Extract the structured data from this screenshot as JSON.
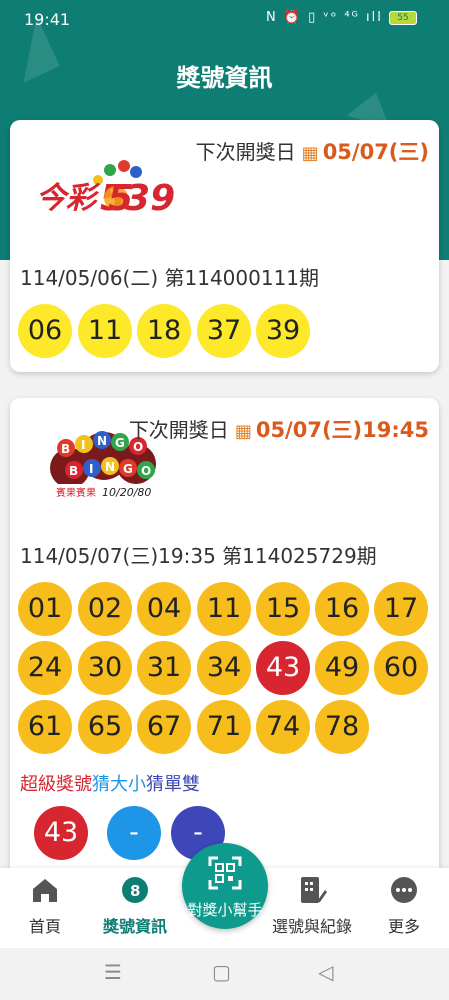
{
  "status_bar": {
    "time": "19:41",
    "icons": "N ⏰ ▯ ᵛᵒ ⁴ᴳ ıll",
    "battery": "55"
  },
  "header": {
    "title": "獎號資訊"
  },
  "card1": {
    "logo_text": "今彩539",
    "next_label": "下次開獎日",
    "next_date": "05/07(三)",
    "period": "114/05/06(二) 第114000111期",
    "balls": [
      "06",
      "11",
      "18",
      "37",
      "39"
    ]
  },
  "card2": {
    "logo_text": "BINGO BINGO",
    "logo_subtext": "賓果賓果",
    "logo_numbers": "10/20/80",
    "next_label": "下次開獎日",
    "next_date": "05/07(三)19:45",
    "period": "114/05/07(三)19:35 第114025729期",
    "balls": [
      "01",
      "02",
      "04",
      "11",
      "15",
      "16",
      "17",
      "24",
      "30",
      "31",
      "34",
      "43",
      "49",
      "60",
      "61",
      "65",
      "67",
      "71",
      "74",
      "78"
    ],
    "highlight_ball": "43",
    "labels": {
      "super": "超級獎號",
      "big_small": "猜大小",
      "odd_even": "猜單雙"
    },
    "extra_balls": [
      "43",
      "-",
      "-"
    ]
  },
  "tabbar": {
    "home": "首頁",
    "results": "獎號資訊",
    "helper": "對獎小幫手",
    "picks": "選號與紀錄",
    "more": "更多"
  },
  "colors": {
    "primary": "#0e7d74",
    "accent": "#d95a1c",
    "ball_yellow": "#fde92a",
    "ball_orange": "#f7bd1c",
    "ball_red": "#d7262f"
  }
}
